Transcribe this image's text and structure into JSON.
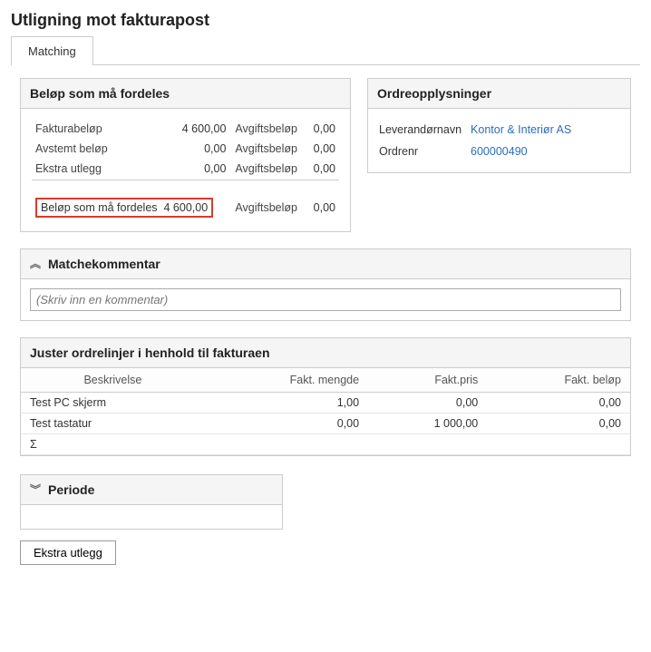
{
  "page_title": "Utligning mot fakturapost",
  "tabs": {
    "matching": "Matching"
  },
  "amounts_panel": {
    "title": "Beløp som må fordeles",
    "rows": [
      {
        "label": "Fakturabeløp",
        "value": "4 600,00",
        "fee_label": "Avgiftsbeløp",
        "fee_value": "0,00"
      },
      {
        "label": "Avstemt beløp",
        "value": "0,00",
        "fee_label": "Avgiftsbeløp",
        "fee_value": "0,00"
      },
      {
        "label": "Ekstra utlegg",
        "value": "0,00",
        "fee_label": "Avgiftsbeløp",
        "fee_value": "0,00"
      }
    ],
    "total": {
      "label": "Beløp som må fordeles",
      "value": "4 600,00",
      "fee_label": "Avgiftsbeløp",
      "fee_value": "0,00"
    }
  },
  "order_panel": {
    "title": "Ordreopplysninger",
    "supplier_label": "Leverandørnavn",
    "supplier_value": "Kontor & Interiør AS",
    "orderno_label": "Ordrenr",
    "orderno_value": "600000490"
  },
  "comment_panel": {
    "title": "Matchekommentar",
    "placeholder": "(Skriv inn en kommentar)"
  },
  "adjust_panel": {
    "title": "Juster ordrelinjer i henhold til fakturaen",
    "columns": {
      "desc": "Beskrivelse",
      "qty": "Fakt. mengde",
      "price": "Fakt.pris",
      "amount": "Fakt. beløp"
    },
    "rows": [
      {
        "desc": "Test PC skjerm",
        "qty": "1,00",
        "price": "0,00",
        "amount": "0,00"
      },
      {
        "desc": "Test tastatur",
        "qty": "0,00",
        "price": "1 000,00",
        "amount": "0,00"
      }
    ],
    "sum_label": "Σ"
  },
  "periode_panel": {
    "title": "Periode"
  },
  "buttons": {
    "extra": "Ekstra utlegg"
  }
}
